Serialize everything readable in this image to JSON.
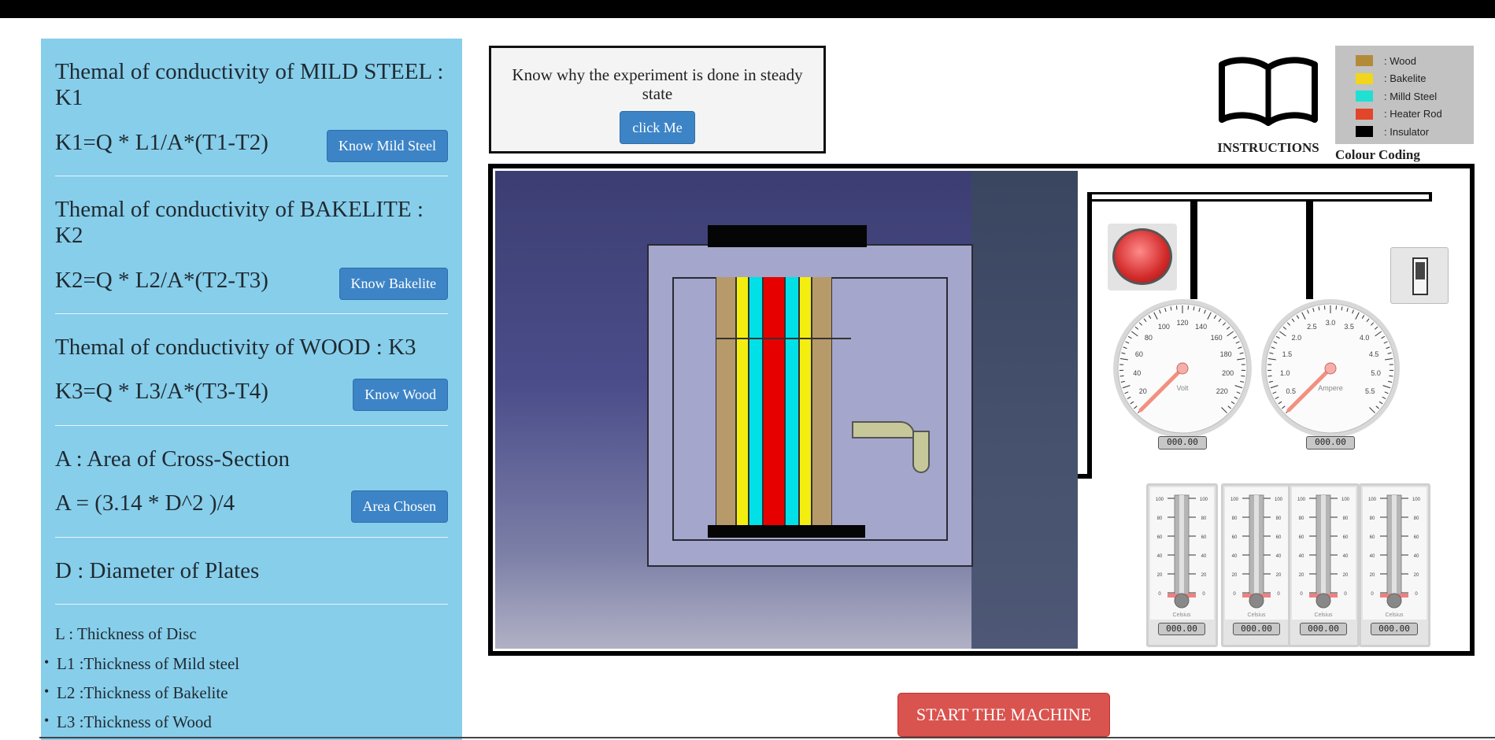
{
  "sections": [
    {
      "title": "Themal of conductivity of MILD STEEL : K1",
      "formula": "K1=Q * L1/A*(T1-T2)",
      "button": "Know Mild Steel"
    },
    {
      "title": "Themal of conductivity of BAKELITE : K2",
      "formula": "K2=Q * L2/A*(T2-T3)",
      "button": "Know Bakelite"
    },
    {
      "title": "Themal of conductivity of WOOD : K3",
      "formula": "K3=Q * L3/A*(T3-T4)",
      "button": "Know Wood"
    },
    {
      "title": "A : Area of Cross-Section",
      "formula": "A = (3.14 * D^2 )/4",
      "button": "Area Chosen"
    },
    {
      "title": "D : Diameter of Plates"
    }
  ],
  "thickness": {
    "heading": "L : Thickness of Disc",
    "items": [
      "L1 :Thickness of Mild steel",
      "L2 :Thickness of Bakelite",
      "L3 :Thickness of Wood"
    ]
  },
  "why_box": {
    "text": "Know why the experiment is done in steady state",
    "button": "click Me"
  },
  "instructions_label": "INSTRUCTIONS",
  "colour_coding": {
    "label": "Colour Coding",
    "items": [
      {
        "label": ": Wood",
        "color": "#b38a3a"
      },
      {
        "label": ": Bakelite",
        "color": "#f1d61d"
      },
      {
        "label": ": Milld Steel",
        "color": "#1fe0d2"
      },
      {
        "label": ": Heater Rod",
        "color": "#e2452a"
      },
      {
        "label": ": Insulator",
        "color": "#000000"
      }
    ]
  },
  "plates": [
    "#b79a6a",
    "#f4ee10",
    "#00e0e6",
    "#e60000",
    "#00e0e6",
    "#f4ee10",
    "#b79a6a"
  ],
  "voltmeter": {
    "unit": "Volt",
    "ticks": [
      "20",
      "40",
      "60",
      "80",
      "100",
      "120",
      "140",
      "160",
      "180",
      "200",
      "220"
    ],
    "readout": "000.00"
  },
  "ammeter": {
    "unit": "Ampere",
    "ticks": [
      "0.5",
      "1.0",
      "1.5",
      "2.0",
      "2.5",
      "3.0",
      "3.5",
      "4.0",
      "4.5",
      "5.0",
      "5.5"
    ],
    "readout": "000.00"
  },
  "thermometers": [
    {
      "readout": "000.00",
      "unit": "Celsius"
    },
    {
      "readout": "000.00",
      "unit": "Celsius"
    },
    {
      "readout": "000.00",
      "unit": "Celsius"
    },
    {
      "readout": "000.00",
      "unit": "Celsius"
    }
  ],
  "thermo_ticks": [
    "100",
    "80",
    "60",
    "40",
    "20",
    "0"
  ],
  "start_button": "START THE MACHINE"
}
